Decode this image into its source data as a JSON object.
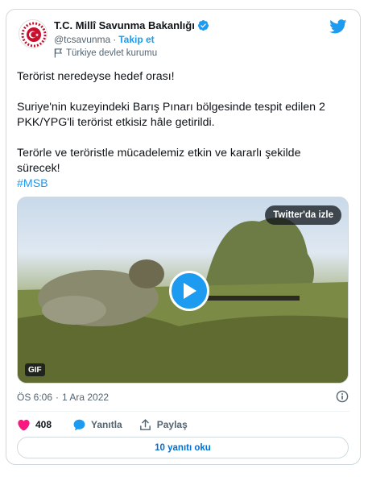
{
  "account": {
    "name": "T.C. Millî Savunma Bakanlığı",
    "handle": "@tcsavunma",
    "separator": "·",
    "follow_label": "Takip et",
    "affiliation_label": "Türkiye devlet kurumu"
  },
  "tweet": {
    "paragraph1": "Terörist neredeyse hedef orası!",
    "paragraph2": "Suriye'nin kuzeyindeki Barış Pınarı bölgesinde tespit edilen 2 PKK/YPG'li terörist etkisiz hâle getirildi.",
    "paragraph3": "Terörle ve teröristle mücadelemiz etkin ve kararlı şekilde sürecek!",
    "hashtag": "#MSB"
  },
  "media": {
    "watch_label": "Twitter'da izle",
    "gif_badge": "GIF"
  },
  "meta": {
    "time": "ÖS 6:06",
    "separator": "·",
    "date": "1 Ara 2022"
  },
  "actions": {
    "like_count": "408",
    "reply_label": "Yanıtla",
    "share_label": "Paylaş"
  },
  "footer": {
    "replies_button": "10 yanıtı oku"
  },
  "colors": {
    "accent": "#1d9bf0",
    "like": "#f91880",
    "text_secondary": "#536471"
  },
  "icons": {
    "verified": "verified-badge-icon",
    "flag": "flag-icon",
    "twitter": "twitter-bird-icon",
    "play": "play-icon",
    "info": "info-icon",
    "like": "heart-icon",
    "reply": "speech-bubble-icon",
    "share": "share-upload-icon"
  }
}
